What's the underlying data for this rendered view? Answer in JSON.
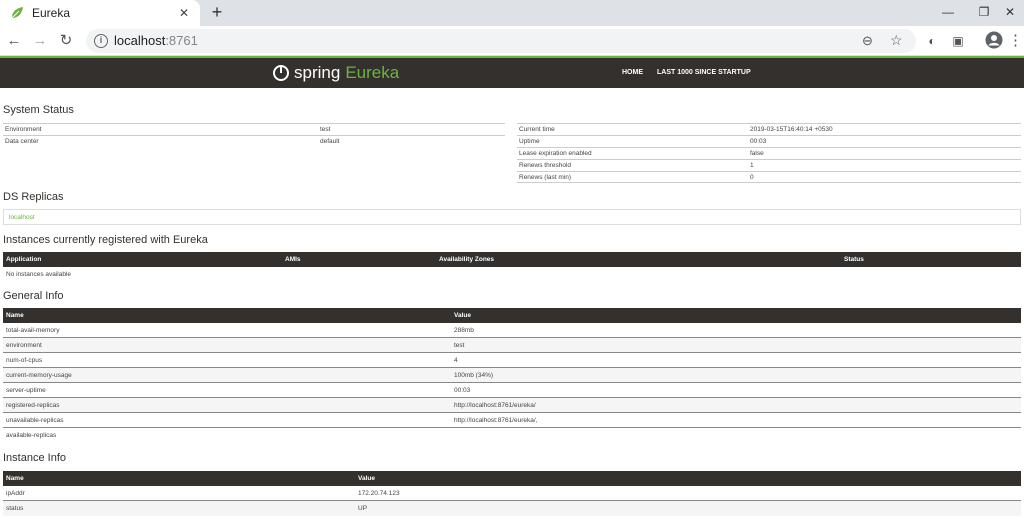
{
  "browser": {
    "tab_title": "Eureka",
    "url_host": "localhost",
    "url_port": ":8761"
  },
  "nav": {
    "brand_spring": "spring",
    "brand_eureka": "Eureka",
    "home": "HOME",
    "last1000": "LAST 1000 SINCE STARTUP"
  },
  "system_status": {
    "title": "System Status",
    "left": [
      {
        "k": "Environment",
        "v": "test"
      },
      {
        "k": "Data center",
        "v": "default"
      }
    ],
    "right": [
      {
        "k": "Current time",
        "v": "2019-03-15T16:40:14 +0530"
      },
      {
        "k": "Uptime",
        "v": "00:03"
      },
      {
        "k": "Lease expiration enabled",
        "v": "false"
      },
      {
        "k": "Renews threshold",
        "v": "1"
      },
      {
        "k": "Renews (last min)",
        "v": "0"
      }
    ]
  },
  "ds_replicas": {
    "title": "DS Replicas",
    "item": "localhost"
  },
  "instances": {
    "title": "Instances currently registered with Eureka",
    "headers": [
      "Application",
      "AMIs",
      "Availability Zones",
      "Status"
    ],
    "empty": "No instances available"
  },
  "general_info": {
    "title": "General Info",
    "headers": [
      "Name",
      "Value"
    ],
    "rows": [
      {
        "k": "total-avail-memory",
        "v": "288mb"
      },
      {
        "k": "environment",
        "v": "test"
      },
      {
        "k": "num-of-cpus",
        "v": "4"
      },
      {
        "k": "current-memory-usage",
        "v": "100mb (34%)"
      },
      {
        "k": "server-uptime",
        "v": "00:03"
      },
      {
        "k": "registered-replicas",
        "v": "http://localhost:8761/eureka/"
      },
      {
        "k": "unavailable-replicas",
        "v": "http://localhost:8761/eureka/,"
      },
      {
        "k": "available-replicas",
        "v": ""
      }
    ]
  },
  "instance_info": {
    "title": "Instance Info",
    "headers": [
      "Name",
      "Value"
    ],
    "rows": [
      {
        "k": "ipAddr",
        "v": "172.20.74.123"
      },
      {
        "k": "status",
        "v": "UP"
      }
    ]
  },
  "colors": {
    "spring_green": "#6db33f",
    "header_dark": "#34302d"
  }
}
